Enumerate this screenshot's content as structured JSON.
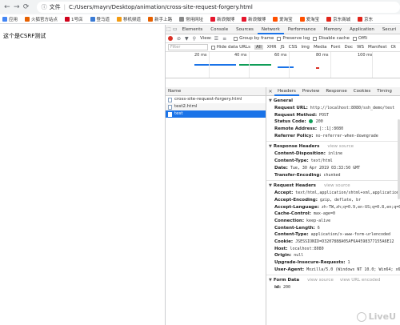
{
  "browser": {
    "url_label": "文件",
    "url": "C:/Users/mayn/Desktop/animation/cross-site-request-forgery.html"
  },
  "bookmarks": [
    {
      "label": "应用",
      "color": "#4285f4"
    },
    {
      "label": "火狐官方站点",
      "color": "#e66000"
    },
    {
      "label": "1号店",
      "color": "#d0021b"
    },
    {
      "label": "登马道",
      "color": "#3a7bd5"
    },
    {
      "label": "移机频道",
      "color": "#f39c12"
    },
    {
      "label": "新手上路",
      "color": "#e66000"
    },
    {
      "label": "常用网址",
      "color": "#888888"
    },
    {
      "label": "新浪微博",
      "color": "#e6162d"
    },
    {
      "label": "新浪微博",
      "color": "#e6162d"
    },
    {
      "label": "爱淘宝",
      "color": "#ff5000"
    },
    {
      "label": "爱淘宝",
      "color": "#ff5000"
    },
    {
      "label": "京东商城",
      "color": "#e1251b"
    },
    {
      "label": "京东",
      "color": "#e1251b"
    }
  ],
  "page": {
    "text": "这个是CSRF测试"
  },
  "devtools": {
    "tabs": [
      "Elements",
      "Console",
      "Sources",
      "Network",
      "Performance",
      "Memory",
      "Application",
      "Securi"
    ],
    "active_tab": "Network",
    "toolbar": {
      "view": "View:",
      "group_by_frame": "Group by frame",
      "preserve_log": "Preserve log",
      "disable_cache": "Disable cache",
      "offline": "Offli"
    },
    "filter": {
      "placeholder": "Filter",
      "hide_data_urls": "Hide data URLs",
      "types": [
        "All",
        "XHR",
        "JS",
        "CSS",
        "Img",
        "Media",
        "Font",
        "Doc",
        "WS",
        "Manifest",
        "Ot"
      ]
    },
    "timeline": {
      "ticks": [
        "20 ms",
        "40 ms",
        "60 ms",
        "80 ms",
        "100 ms"
      ]
    },
    "requests": {
      "header": "Name",
      "items": [
        {
          "name": "cross-site-request-forgery.html",
          "selected": false
        },
        {
          "name": "test2.html",
          "selected": false
        },
        {
          "name": "test",
          "selected": true
        }
      ]
    },
    "detail_tabs": {
      "close": "✕",
      "tabs": [
        "Headers",
        "Preview",
        "Response",
        "Cookies",
        "Timing"
      ],
      "active": "Headers"
    },
    "general": {
      "title": "General",
      "rows": [
        {
          "k": "Request URL:",
          "v": "http://localhost:8080/ssh_demo/test"
        },
        {
          "k": "Request Method:",
          "v": "POST"
        },
        {
          "k": "Status Code:",
          "v": "200",
          "status_color": "#0f9d58"
        },
        {
          "k": "Remote Address:",
          "v": "[::1]:8080"
        },
        {
          "k": "Referrer Policy:",
          "v": "no-referrer-when-downgrade"
        }
      ]
    },
    "response_headers": {
      "title": "Response Headers",
      "view_source": "view source",
      "rows": [
        {
          "k": "Content-Disposition:",
          "v": "inline"
        },
        {
          "k": "Content-Type:",
          "v": "text/html"
        },
        {
          "k": "Date:",
          "v": "Tue, 30 Apr 2019 03:33:50 GMT"
        },
        {
          "k": "Transfer-Encoding:",
          "v": "chunked"
        }
      ]
    },
    "request_headers": {
      "title": "Request Headers",
      "view_source": "view source",
      "rows": [
        {
          "k": "Accept:",
          "v": "text/html,application/xhtml+xml,application"
        },
        {
          "k": "Accept-Encoding:",
          "v": "gzip, deflate, br"
        },
        {
          "k": "Accept-Language:",
          "v": "zh-TW,zh;q=0.9,en-US;q=0.8,en;q=0."
        },
        {
          "k": "Cache-Control:",
          "v": "max-age=0"
        },
        {
          "k": "Connection:",
          "v": "keep-alive"
        },
        {
          "k": "Content-Length:",
          "v": "6"
        },
        {
          "k": "Content-Type:",
          "v": "application/x-www-form-urlencoded"
        },
        {
          "k": "Cookie:",
          "v": "JSESSIONID=D3207888A05AF6A4598377155A6E12"
        },
        {
          "k": "Host:",
          "v": "localhost:8080"
        },
        {
          "k": "Origin:",
          "v": "null"
        },
        {
          "k": "Upgrade-Insecure-Requests:",
          "v": "1"
        },
        {
          "k": "User-Agent:",
          "v": "Mozilla/5.0 (Windows NT 10.0; Win64; x6"
        }
      ]
    },
    "form_data": {
      "title": "Form Data",
      "view_source": "view source",
      "view_url_encoded": "view URL encoded",
      "rows": [
        {
          "k": "id:",
          "v": "200"
        }
      ]
    },
    "watermark": "LiveU"
  }
}
